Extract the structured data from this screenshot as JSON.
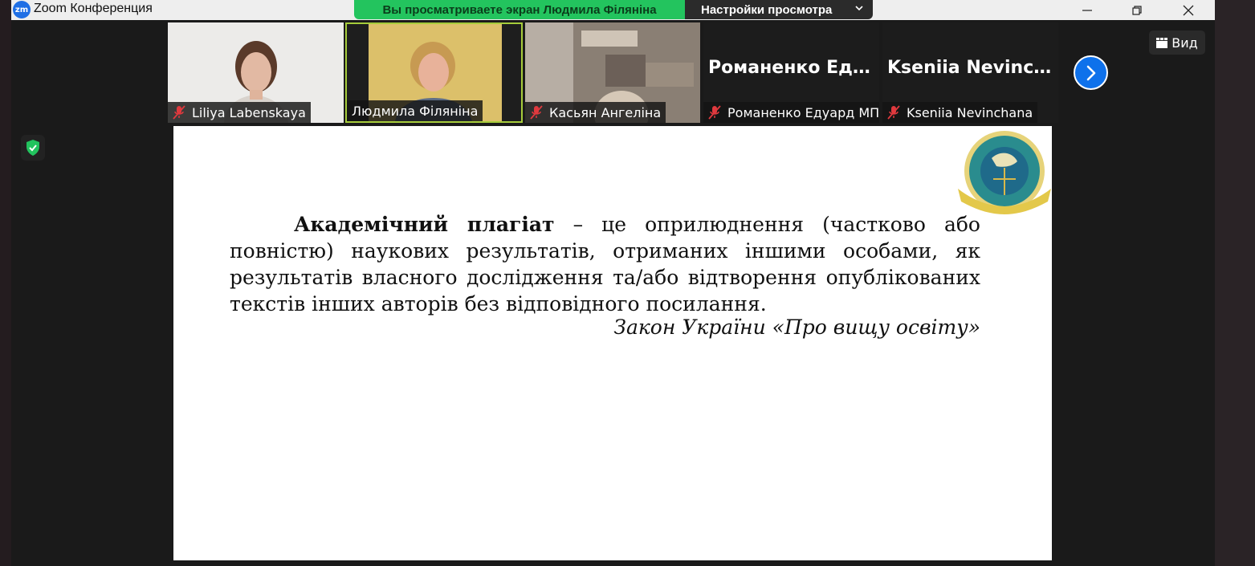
{
  "window": {
    "title": "Zoom Конференция",
    "logo_text": "zm"
  },
  "share_banner": {
    "message": "Вы просматриваете экран Людмила Філяніна",
    "view_settings_label": "Настройки просмотра"
  },
  "participants": [
    {
      "name": "Liliya Labenskaya",
      "muted": true,
      "video": true
    },
    {
      "name": "Людмила Філяніна",
      "muted": false,
      "video": true,
      "active_speaker": true
    },
    {
      "name": "Касьян Ангеліна",
      "muted": true,
      "video": true
    },
    {
      "name": "Романенко Едуард МП...",
      "display_name": "Романенко Еду...",
      "muted": true,
      "video": false
    },
    {
      "name": "Kseniia Nevinchana",
      "display_name": "Kseniia Nevinch...",
      "muted": true,
      "video": false
    }
  ],
  "toolbar": {
    "view_label": "Вид"
  },
  "slide": {
    "term": "Академічний плагіат",
    "definition": " – це оприлюднення (частково або повністю) наукових результатів, отриманих іншими особами, як результатів власного дослідження та/або відтворення опублікованих текстів інших авторів без відповідного посилання.",
    "citation": "Закон України «Про вищу освіту»"
  },
  "colors": {
    "accent_blue": "#0e71eb",
    "share_green": "#23c45e",
    "mute_red": "#e0393e",
    "active_speaker_border": "#a6cc3b"
  }
}
